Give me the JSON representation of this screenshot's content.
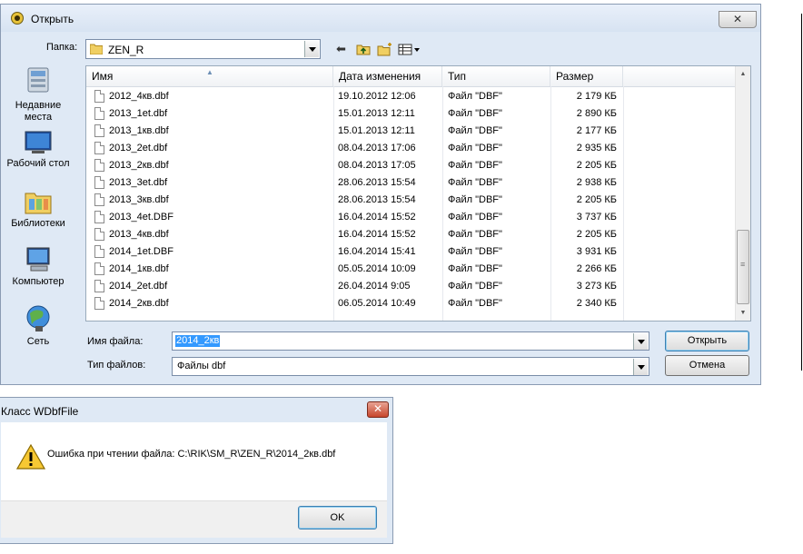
{
  "open_dialog": {
    "title": "Открыть",
    "folder_label": "Папка:",
    "folder_value": "ZEN_R",
    "places": [
      {
        "label": "Недавние места",
        "icon": "recent-places-icon"
      },
      {
        "label": "Рабочий стол",
        "icon": "desktop-icon"
      },
      {
        "label": "Библиотеки",
        "icon": "libraries-icon"
      },
      {
        "label": "Компьютер",
        "icon": "computer-icon"
      },
      {
        "label": "Сеть",
        "icon": "network-icon"
      }
    ],
    "columns": {
      "name": "Имя",
      "date": "Дата изменения",
      "type": "Тип",
      "size": "Размер"
    },
    "files": [
      {
        "name": "2012_4кв.dbf",
        "date": "19.10.2012 12:06",
        "type": "Файл \"DBF\"",
        "size": "2 179 КБ"
      },
      {
        "name": "2013_1et.dbf",
        "date": "15.01.2013 12:11",
        "type": "Файл \"DBF\"",
        "size": "2 890 КБ"
      },
      {
        "name": "2013_1кв.dbf",
        "date": "15.01.2013 12:11",
        "type": "Файл \"DBF\"",
        "size": "2 177 КБ"
      },
      {
        "name": "2013_2et.dbf",
        "date": "08.04.2013 17:06",
        "type": "Файл \"DBF\"",
        "size": "2 935 КБ"
      },
      {
        "name": "2013_2кв.dbf",
        "date": "08.04.2013 17:05",
        "type": "Файл \"DBF\"",
        "size": "2 205 КБ"
      },
      {
        "name": "2013_3et.dbf",
        "date": "28.06.2013 15:54",
        "type": "Файл \"DBF\"",
        "size": "2 938 КБ"
      },
      {
        "name": "2013_3кв.dbf",
        "date": "28.06.2013 15:54",
        "type": "Файл \"DBF\"",
        "size": "2 205 КБ"
      },
      {
        "name": "2013_4et.DBF",
        "date": "16.04.2014 15:52",
        "type": "Файл \"DBF\"",
        "size": "3 737 КБ"
      },
      {
        "name": "2013_4кв.dbf",
        "date": "16.04.2014 15:52",
        "type": "Файл \"DBF\"",
        "size": "2 205 КБ"
      },
      {
        "name": "2014_1et.DBF",
        "date": "16.04.2014 15:41",
        "type": "Файл \"DBF\"",
        "size": "3 931 КБ"
      },
      {
        "name": "2014_1кв.dbf",
        "date": "05.05.2014 10:09",
        "type": "Файл \"DBF\"",
        "size": "2 266 КБ"
      },
      {
        "name": "2014_2et.dbf",
        "date": "26.04.2014 9:05",
        "type": "Файл \"DBF\"",
        "size": "3 273 КБ"
      },
      {
        "name": "2014_2кв.dbf",
        "date": "06.05.2014 10:49",
        "type": "Файл \"DBF\"",
        "size": "2 340 КБ"
      }
    ],
    "filename_label": "Имя файла:",
    "filename_value": "2014_2кв",
    "filetype_label": "Тип файлов:",
    "filetype_value": "Файлы dbf",
    "open_button": "Открыть",
    "cancel_button": "Отмена",
    "close_glyph": "✕"
  },
  "error_dialog": {
    "title": "Класс WDbfFile",
    "message": "Ошибка при чтении файла: C:\\RIK\\SM_R\\ZEN_R\\2014_2кв.dbf",
    "ok_button": "OK",
    "close_glyph": "✕"
  }
}
